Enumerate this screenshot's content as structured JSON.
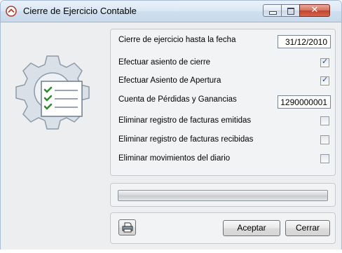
{
  "window": {
    "title": "Cierre de Ejercicio Contable",
    "close_symbol": "✕",
    "icons": [
      "app-icon",
      "minimize-icon",
      "maximize-icon",
      "close-icon"
    ]
  },
  "illustration": {
    "icon": "settings-checklist-gear-icon"
  },
  "form": {
    "fecha_label": "Cierre de ejercicio hasta la fecha",
    "fecha_value": "31/12/2010",
    "asiento_cierre_label": "Efectuar asiento de cierre",
    "asiento_cierre_checked": true,
    "asiento_apertura_label": "Efectuar Asiento de Apertura",
    "asiento_apertura_checked": true,
    "cuenta_label": "Cuenta de Pérdidas y Ganancias",
    "cuenta_value": "1290000001",
    "eliminar_emitidas_label": "Eliminar registro de facturas emitidas",
    "eliminar_emitidas_checked": false,
    "eliminar_recibidas_label": "Eliminar registro de facturas recibidas",
    "eliminar_recibidas_checked": false,
    "eliminar_movimientos_label": "Eliminar movimientos del diario",
    "eliminar_movimientos_checked": false
  },
  "progress": {
    "value": 0
  },
  "buttons": {
    "print_icon": "printer-icon",
    "accept_label": "Aceptar",
    "close_label": "Cerrar"
  },
  "colors": {
    "titlebar": "#d0dfee",
    "close_button": "#c0432b",
    "checkmark": "#1e4a9a"
  }
}
